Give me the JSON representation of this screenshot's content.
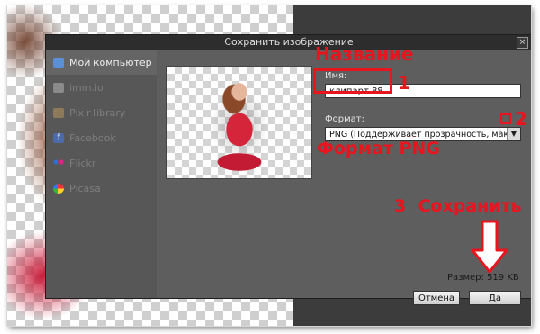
{
  "dialog": {
    "title": "Сохранить изображение",
    "close_glyph": "×"
  },
  "sidebar": {
    "items": [
      {
        "label": "Мой компьютер",
        "icon": "monitor-icon",
        "active": true
      },
      {
        "label": "imm.io",
        "icon": "image-icon",
        "active": false
      },
      {
        "label": "Pixlr library",
        "icon": "library-icon",
        "active": false
      },
      {
        "label": "Facebook",
        "icon": "facebook-icon",
        "active": false
      },
      {
        "label": "Flickr",
        "icon": "flickr-icon",
        "active": false
      },
      {
        "label": "Picasa",
        "icon": "picasa-icon",
        "active": false
      }
    ]
  },
  "form": {
    "name_label": "Имя:",
    "name_value": "клипарт 88",
    "format_label": "Формат:",
    "format_value": "PNG (Поддерживает прозрачность, макс",
    "size_text": "Размер: 519 KB"
  },
  "buttons": {
    "cancel": "Отмена",
    "ok": "Да"
  },
  "annotations": {
    "name_note": "Название",
    "step1": "1",
    "step2": "2",
    "format_note": "Формат PNG",
    "save_note": "3  Сохранить"
  },
  "colors": {
    "annotation": "#e8141e",
    "dialog_bg": "#525252",
    "titlebar": "#2d2d2d"
  }
}
